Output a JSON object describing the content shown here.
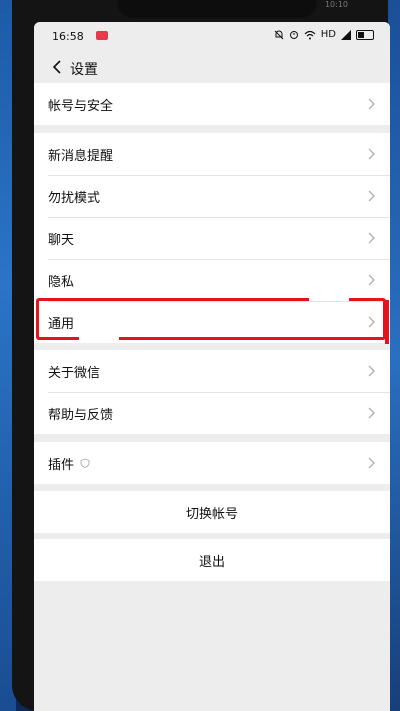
{
  "status_bar": {
    "time": "16:58",
    "signal_text": "HD",
    "top_right_time": "10:10"
  },
  "nav": {
    "title": "设置"
  },
  "groups": [
    {
      "items": [
        "帐号与安全"
      ]
    },
    {
      "items": [
        "新消息提醒",
        "勿扰模式",
        "聊天",
        "隐私",
        "通用"
      ]
    },
    {
      "items": [
        "关于微信",
        "帮助与反馈"
      ]
    },
    {
      "items": [
        "插件"
      ]
    }
  ],
  "actions": {
    "switch_account": "切换帐号",
    "logout": "退出"
  },
  "colors": {
    "highlight": "#e4141f",
    "background": "#ededed",
    "badge": "#e6394a"
  }
}
